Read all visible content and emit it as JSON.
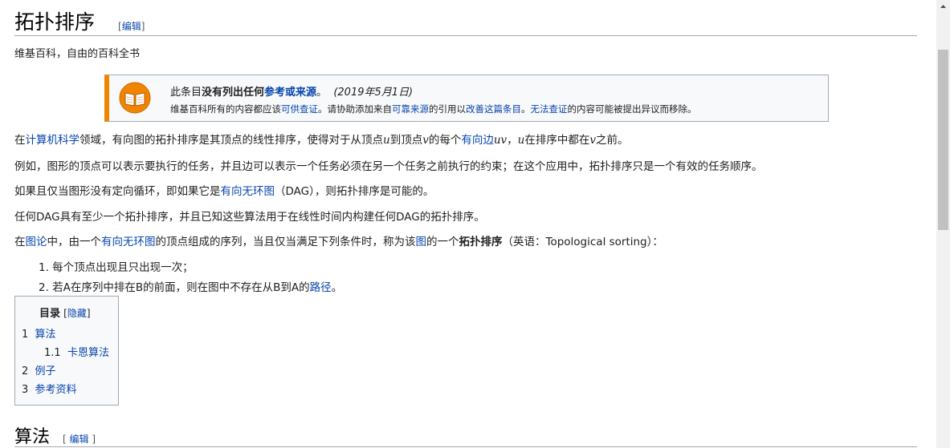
{
  "title": "拓扑排序",
  "edit_label": "编辑",
  "tagline": "维基百科，自由的百科全书",
  "notice": {
    "l1_pre": "此条目",
    "l1_bold": "没有列出任何",
    "l1_link1": "参考或来源",
    "l1_end": "。",
    "date": "(2019年5月1日)",
    "l2_a": "维基百科所有的内容都应该",
    "l2_link1": "可供查证",
    "l2_b": "。请协助添加来自",
    "l2_link2": "可靠来源",
    "l2_c": "的引用以",
    "l2_link3": "改善这篇条目",
    "l2_d": "。",
    "l2_link4": "无法查证",
    "l2_e": "的内容可能被提出异议而移除。",
    "icon": "book-icon"
  },
  "p1": {
    "a": "在",
    "link1": "计算机科学",
    "b": "领域，有向图的拓扑排序是其顶点的线性排序，使得对于从顶点",
    "m1": "u",
    "c": "到顶点",
    "m2": "v",
    "d": "的每个",
    "link2": "有向边",
    "m3": "uv",
    "e": "，",
    "m4": "u",
    "f": "在排序中都在",
    "m5": "v",
    "g": "之前。"
  },
  "p2": "例如，图形的顶点可以表示要执行的任务，并且边可以表示一个任务必须在另一个任务之前执行的约束；在这个应用中，拓扑排序只是一个有效的任务顺序。",
  "p3": {
    "a": "如果且仅当图形没有定向循环，即如果它是",
    "link1": "有向无环图",
    "b": "（DAG），则拓扑排序是可能的。"
  },
  "p4": "任何DAG具有至少一个拓扑排序，并且已知这些算法用于在线性时间内构建任何DAG的拓扑排序。",
  "p5": {
    "a": "在",
    "link1": "图论",
    "b": "中，由一个",
    "link2": "有向无环图",
    "c": "的顶点组成的序列，当且仅当满足下列条件时，称为该",
    "link3": "图",
    "d": "的一个",
    "bold": "拓扑排序",
    "e": "（英语：Topological sorting）："
  },
  "list": {
    "item1": "1. 每个顶点出现且只出现一次；",
    "item2_pre": "2. 若A在序列中排在B的前面，则在图中不存在从B到A的",
    "item2_link": "路径",
    "item2_end": "。"
  },
  "toc": {
    "title": "目录",
    "toggle": "隐藏",
    "items": [
      {
        "num": "1",
        "label": "算法"
      },
      {
        "num": "1.1",
        "label": "卡恩算法"
      },
      {
        "num": "2",
        "label": "例子"
      },
      {
        "num": "3",
        "label": "参考资料"
      }
    ]
  },
  "section1": {
    "title": "算法"
  }
}
